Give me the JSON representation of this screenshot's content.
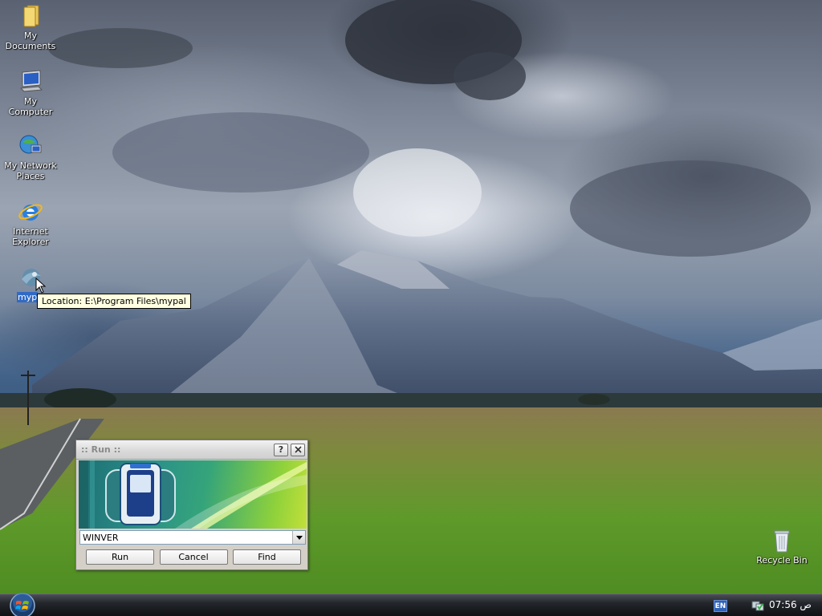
{
  "desktop": {
    "icons": [
      {
        "label": "My Documents",
        "icon": "folder-icon"
      },
      {
        "label": "My Computer",
        "icon": "computer-icon"
      },
      {
        "label": "My Network Places",
        "label_line1": "My Network",
        "label_line2": "Places",
        "icon": "network-icon"
      },
      {
        "label": "Internet Explorer",
        "label_line1": "Internet",
        "label_line2": "Explorer",
        "icon": "ie-icon"
      },
      {
        "label": "myp",
        "icon": "mypal-icon",
        "selected": true
      },
      {
        "label": "Recycle Bin",
        "icon": "recycle-bin-icon"
      }
    ],
    "tooltip": "Location: E:\\Program Files\\mypal"
  },
  "run_dialog": {
    "title": ":: Run ::",
    "help_label": "?",
    "close_label": "X",
    "command_value": "WINVER",
    "buttons": {
      "run": "Run",
      "cancel": "Cancel",
      "find": "Find"
    }
  },
  "taskbar": {
    "language": "EN",
    "clock": "07:56 ص",
    "start_icon": "windows-orb-icon"
  },
  "colors": {
    "selection": "#316ac5",
    "tooltip_bg": "#ffffe1",
    "dialog_bg": "#d4d0c8",
    "banner_green": "#8ed13b",
    "taskbar": "#1a1c20"
  }
}
